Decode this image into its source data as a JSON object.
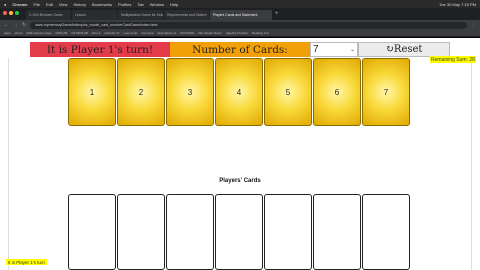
{
  "menubar": {
    "app": "Chrome",
    "items": [
      "File",
      "Edit",
      "View",
      "History",
      "Bookmarks",
      "Profiles",
      "Tab",
      "Window",
      "Help"
    ],
    "clock": "Tue 30 May 7:15 PM"
  },
  "tabs": [
    {
      "label": "C-Grid Browser Game"
    },
    {
      "label": "Lesson"
    },
    {
      "label": "Multiplication Game for Kids"
    },
    {
      "label": "Requirements and Statem"
    },
    {
      "label": "Players Cards and Statement",
      "active": true
    }
  ],
  "address": {
    "url": "www.mymemoryGame/indexplus_model_card_numberCardGame/index.html"
  },
  "bookmarks": [
    "Apps",
    "Zoom",
    "Math Games Hous",
    "MATLAB",
    "C# MATLAB",
    "Intro 4",
    "Calculus IV",
    "Leet Code",
    "Coursera",
    "Entertainment",
    "DOCKING",
    "Dev Studio Room",
    "Algebra Practice",
    "Reading List"
  ],
  "game": {
    "turn_text": "It is Player 1's turn!",
    "count_label": "Number of Cards:",
    "count_value": "7",
    "reset_label": "↻Reset",
    "remaining_text": "Remaining Sum: 28",
    "cards": [
      "1",
      "2",
      "3",
      "4",
      "5",
      "6",
      "7"
    ],
    "players_title": "Players' Cards",
    "status_text": "It is Player 1's turn",
    "colors": {
      "turn": "#e33b4a",
      "count": "#f2a007",
      "card": "#f9d93a",
      "highlight": "#ffff00"
    }
  }
}
